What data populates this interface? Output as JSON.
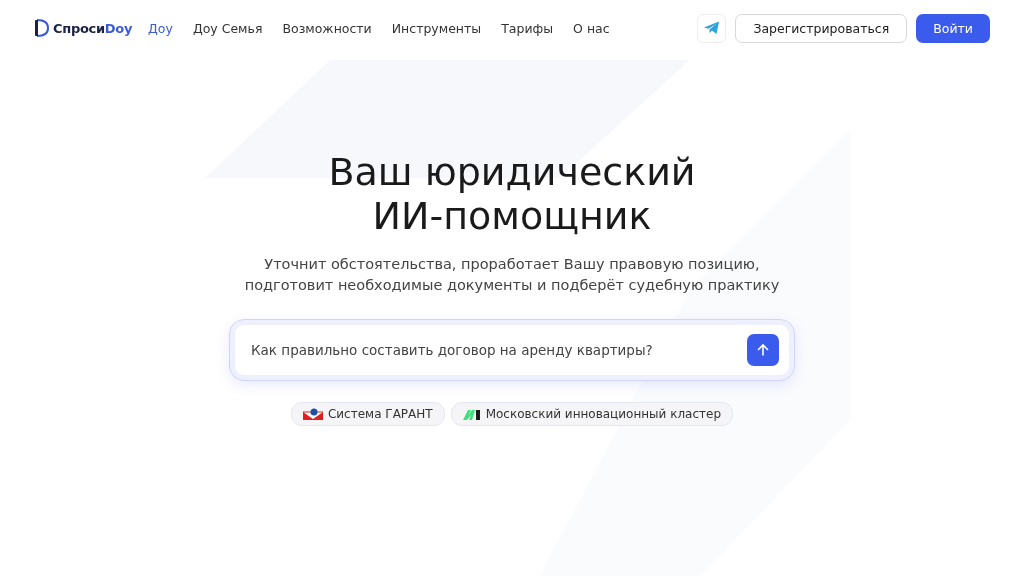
{
  "header": {
    "logo": {
      "prefix": "Спроси",
      "suffix": "Doy"
    },
    "nav": [
      {
        "label": "Доу",
        "selected": true
      },
      {
        "label": "Доу Семья",
        "selected": false
      },
      {
        "label": "Возможности",
        "selected": false
      },
      {
        "label": "Инструменты",
        "selected": false
      },
      {
        "label": "Тарифы",
        "selected": false
      },
      {
        "label": "О нас",
        "selected": false
      }
    ],
    "register_button": "Зарегистрироваться",
    "login_button": "Войти"
  },
  "hero": {
    "title_lines": [
      "Ваш юридический",
      "ИИ-помощник"
    ],
    "subtitle_lines": [
      "Уточнит обстоятельства, проработает Вашу правовую позицию,",
      "подготовит необходимые документы и подберёт судебную практику"
    ],
    "search": {
      "placeholder": "Как правильно составить договор на аренду квартиры?"
    },
    "partners": [
      {
        "kind": "garant",
        "label": "Система ГАРАНТ"
      },
      {
        "kind": "mik",
        "label": "Московский инновационный кластер"
      }
    ]
  }
}
